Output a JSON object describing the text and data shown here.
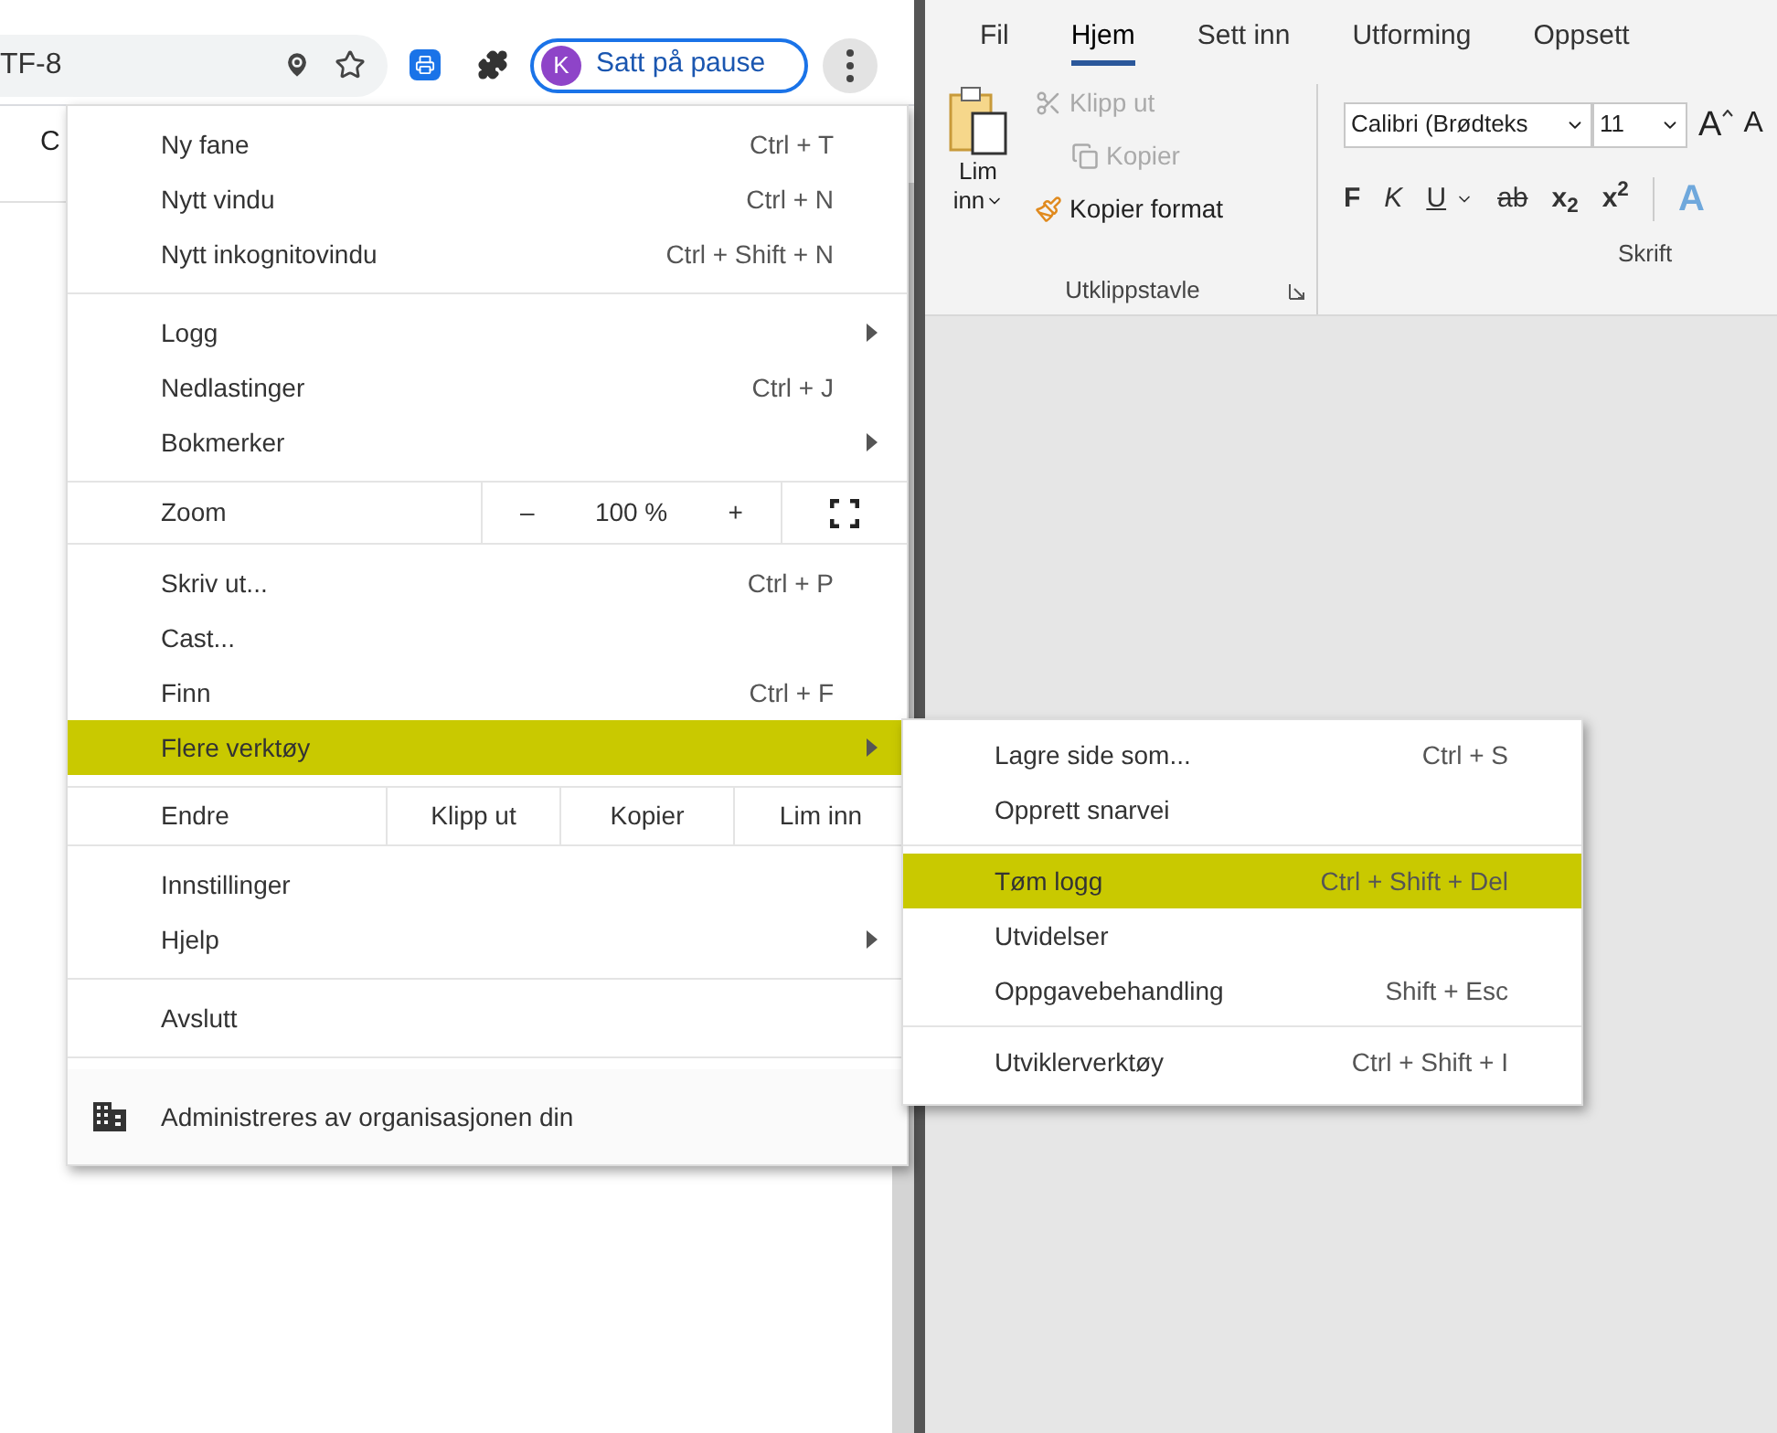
{
  "browser": {
    "address_text": "TF-8",
    "profile": {
      "initial": "K",
      "label": "Satt på pause"
    },
    "page_text": "C"
  },
  "menu": {
    "sections": [
      {
        "items": [
          {
            "kind": "item",
            "label": "Ny fane",
            "shortcut": "Ctrl + T",
            "submenu": false,
            "selected": false
          },
          {
            "kind": "item",
            "label": "Nytt vindu",
            "shortcut": "Ctrl + N",
            "submenu": false,
            "selected": false
          },
          {
            "kind": "item",
            "label": "Nytt inkognitovindu",
            "shortcut": "Ctrl + Shift + N",
            "submenu": false,
            "selected": false
          }
        ]
      },
      {
        "items": [
          {
            "kind": "item",
            "label": "Logg",
            "submenu": true,
            "selected": false
          },
          {
            "kind": "item",
            "label": "Nedlastinger",
            "shortcut": "Ctrl + J",
            "submenu": false,
            "selected": false
          },
          {
            "kind": "item",
            "label": "Bokmerker",
            "submenu": true,
            "selected": false
          }
        ]
      },
      {
        "items": [
          {
            "kind": "zoom",
            "label": "Zoom",
            "minus": "–",
            "value": "100 %",
            "plus": "+"
          }
        ]
      },
      {
        "items": [
          {
            "kind": "item",
            "label": "Skriv ut...",
            "shortcut": "Ctrl + P",
            "submenu": false,
            "selected": false
          },
          {
            "kind": "item",
            "label": "Cast...",
            "submenu": false,
            "selected": false
          },
          {
            "kind": "item",
            "label": "Finn",
            "shortcut": "Ctrl + F",
            "submenu": false,
            "selected": false
          },
          {
            "kind": "item",
            "label": "Flere verktøy",
            "submenu": true,
            "selected": true
          }
        ]
      },
      {
        "items": [
          {
            "kind": "edit",
            "label": "Endre",
            "buttons": [
              "Klipp ut",
              "Kopier",
              "Lim inn"
            ]
          }
        ]
      },
      {
        "items": [
          {
            "kind": "item",
            "label": "Innstillinger",
            "submenu": false,
            "selected": false
          },
          {
            "kind": "item",
            "label": "Hjelp",
            "submenu": true,
            "selected": false
          }
        ]
      },
      {
        "items": [
          {
            "kind": "item",
            "label": "Avslutt",
            "submenu": false,
            "selected": false
          }
        ]
      },
      {
        "items": [
          {
            "kind": "managed",
            "label": "Administreres av organisasjonen din"
          }
        ]
      }
    ]
  },
  "submenu": {
    "sections": [
      {
        "items": [
          {
            "label": "Lagre side som...",
            "shortcut": "Ctrl + S",
            "selected": false
          },
          {
            "label": "Opprett snarvei",
            "selected": false
          }
        ]
      },
      {
        "items": [
          {
            "label": "Tøm logg",
            "shortcut": "Ctrl + Shift + Del",
            "selected": true
          },
          {
            "label": "Utvidelser",
            "selected": false
          },
          {
            "label": "Oppgavebehandling",
            "shortcut": "Shift + Esc",
            "selected": false
          }
        ]
      },
      {
        "items": [
          {
            "label": "Utviklerverktøy",
            "shortcut": "Ctrl + Shift + I",
            "selected": false
          }
        ]
      }
    ]
  },
  "word": {
    "tabs": [
      {
        "label": "Fil",
        "selected": false
      },
      {
        "label": "Hjem",
        "selected": true
      },
      {
        "label": "Sett inn",
        "selected": false
      },
      {
        "label": "Utforming",
        "selected": false
      },
      {
        "label": "Oppsett",
        "selected": false
      }
    ],
    "clipboard": {
      "paste_top": "Lim",
      "paste_bottom": "inn",
      "cut": "Klipp ut",
      "copy": "Kopier",
      "format": "Kopier format",
      "group": "Utklippstavle"
    },
    "font": {
      "name": "Calibri (Brødteks",
      "size": "11",
      "grow": "A",
      "shrink": "A",
      "bold": "F",
      "italic": "K",
      "underline": "U",
      "strike": "ab",
      "subscript": "x$_{2}$",
      "superscript": "x$^{2}$",
      "effects": "A",
      "group": "Skrift"
    }
  }
}
